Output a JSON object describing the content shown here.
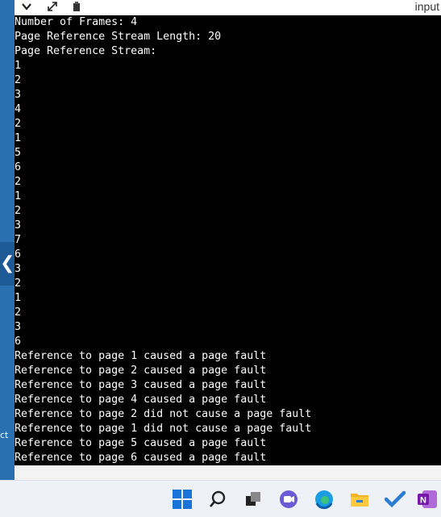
{
  "window": {
    "title": "input"
  },
  "toolbar": {
    "icons": [
      "chevron-down-icon",
      "expand-icon",
      "clipboard-icon"
    ]
  },
  "left_strip": {
    "partial_text": "ct"
  },
  "console": {
    "lines": [
      "Number of Frames: 4",
      "Page Reference Stream Length: 20",
      "Page Reference Stream:",
      "1",
      "2",
      "3",
      "4",
      "2",
      "1",
      "5",
      "6",
      "2",
      "1",
      "2",
      "3",
      "7",
      "6",
      "3",
      "2",
      "1",
      "2",
      "3",
      "6",
      "Reference to page 1 caused a page fault",
      "Reference to page 2 caused a page fault",
      "Reference to page 3 caused a page fault",
      "Reference to page 4 caused a page fault",
      "Reference to page 2 did not cause a page fault",
      "Reference to page 1 did not cause a page fault",
      "Reference to page 5 caused a page fault",
      "Reference to page 6 caused a page fault"
    ]
  },
  "taskbar": {
    "icons": [
      "windows-start-icon",
      "search-icon",
      "task-view-icon",
      "chat-icon",
      "edge-browser-icon",
      "file-explorer-icon",
      "todo-icon",
      "onenote-icon"
    ],
    "onenote_letter": "N"
  },
  "colors": {
    "console_bg": "#000000",
    "console_text": "#ffffff",
    "accent_blue": "#2a6fb0",
    "taskbar_bg": "#eef1f6"
  }
}
